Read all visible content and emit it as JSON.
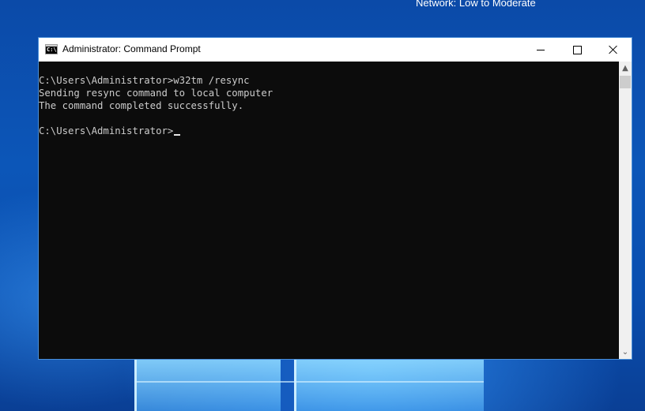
{
  "desktop": {
    "notification_text": "Network: Low to Moderate"
  },
  "window": {
    "title": "Administrator: Command Prompt",
    "icon_name": "cmd-icon",
    "icon_label": "C:\\",
    "controls": {
      "minimize": "minimize-icon",
      "maximize": "maximize-icon",
      "close": "close-icon"
    }
  },
  "console": {
    "lines": [
      "C:\\Users\\Administrator>w32tm /resync",
      "Sending resync command to local computer",
      "The command completed successfully.",
      "",
      "C:\\Users\\Administrator>"
    ]
  },
  "scrollbar": {
    "up_glyph": "▲",
    "down_glyph": "⌄"
  },
  "colors": {
    "console_background": "#0c0c0c",
    "console_text": "#cccccc",
    "titlebar": "#ffffff",
    "window_border": "#4a8fd9",
    "desktop_accent": "#0c56b8"
  }
}
